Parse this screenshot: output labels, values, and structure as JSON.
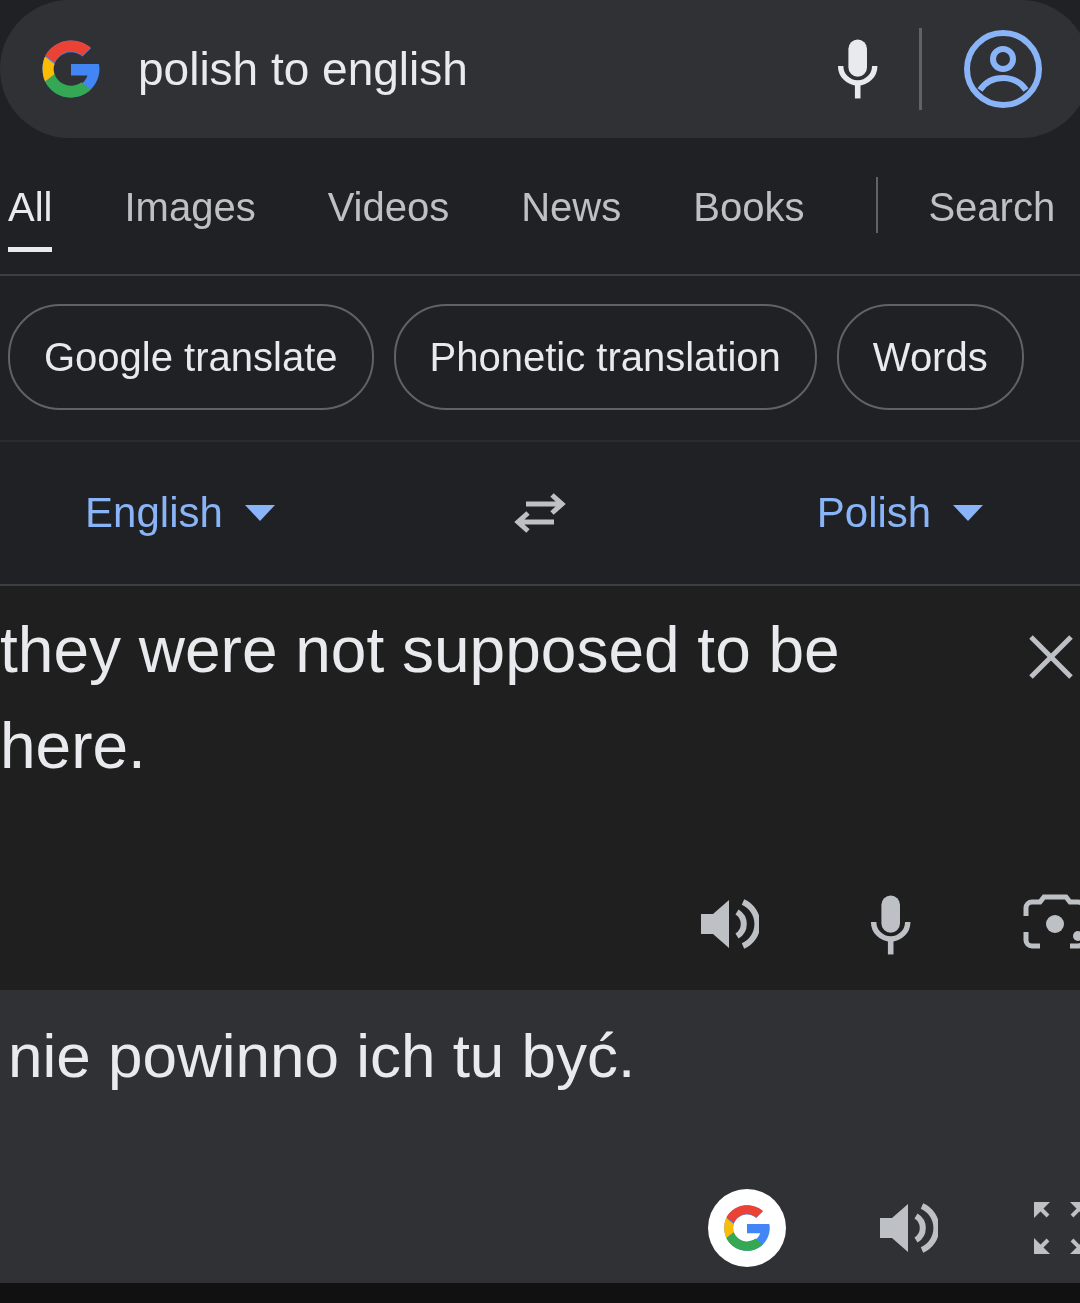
{
  "search": {
    "query": "polish to english"
  },
  "tabs": [
    {
      "label": "All",
      "selected": true
    },
    {
      "label": "Images",
      "selected": false
    },
    {
      "label": "Videos",
      "selected": false
    },
    {
      "label": "News",
      "selected": false
    },
    {
      "label": "Books",
      "selected": false
    },
    {
      "label": "Search",
      "selected": false
    }
  ],
  "chips": [
    {
      "label": "Google translate"
    },
    {
      "label": "Phonetic translation"
    },
    {
      "label": "Words"
    }
  ],
  "translator": {
    "source_language": "English",
    "target_language": "Polish",
    "input": "they were not supposed to be here.",
    "output": "nie powinno ich tu być."
  }
}
